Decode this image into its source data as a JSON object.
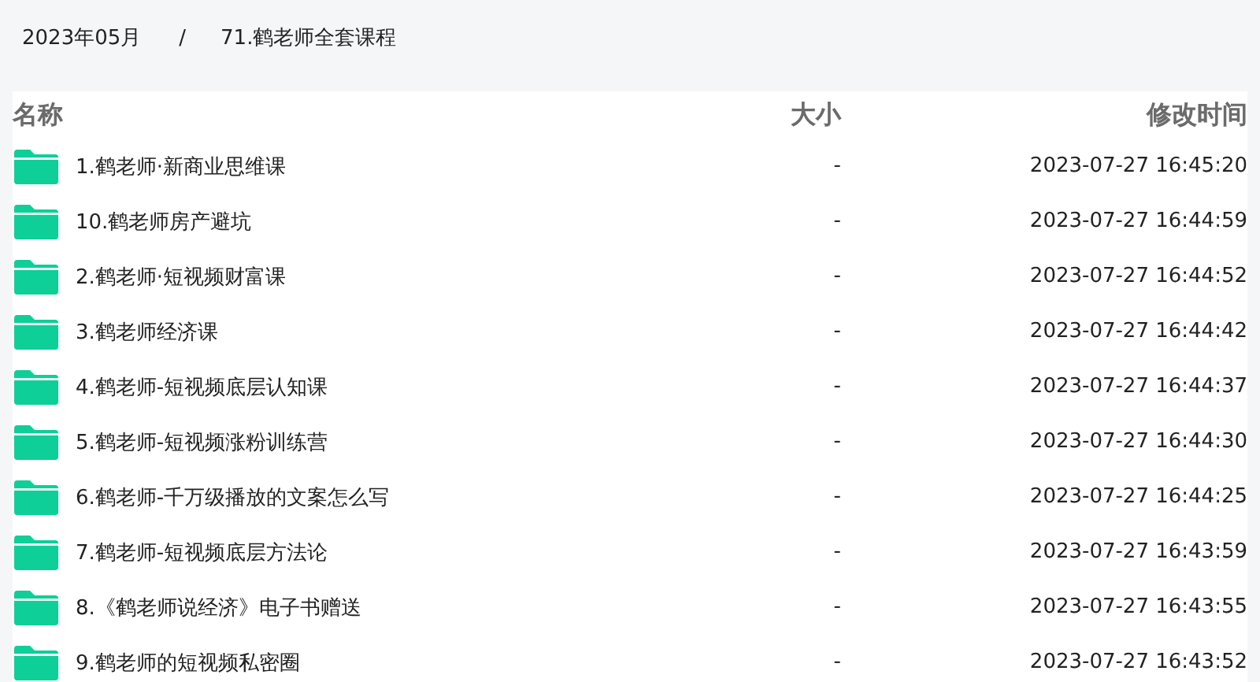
{
  "breadcrumb": {
    "items": [
      "2023年05月",
      "71.鹤老师全套课程"
    ],
    "separator": "/"
  },
  "table": {
    "columns": [
      "名称",
      "大小",
      "修改时间"
    ],
    "rows": [
      {
        "name": "1.鹤老师·新商业思维课",
        "size": "-",
        "modified": "2023-07-27 16:45:20"
      },
      {
        "name": "10.鹤老师房产避坑",
        "size": "-",
        "modified": "2023-07-27 16:44:59"
      },
      {
        "name": "2.鹤老师·短视频财富课",
        "size": "-",
        "modified": "2023-07-27 16:44:52"
      },
      {
        "name": "3.鹤老师经济课",
        "size": "-",
        "modified": "2023-07-27 16:44:42"
      },
      {
        "name": "4.鹤老师-短视频底层认知课",
        "size": "-",
        "modified": "2023-07-27 16:44:37"
      },
      {
        "name": "5.鹤老师-短视频涨粉训练营",
        "size": "-",
        "modified": "2023-07-27 16:44:30"
      },
      {
        "name": "6.鹤老师-千万级播放的文案怎么写",
        "size": "-",
        "modified": "2023-07-27 16:44:25"
      },
      {
        "name": "7.鹤老师-短视频底层方法论",
        "size": "-",
        "modified": "2023-07-27 16:43:59"
      },
      {
        "name": "8.《鹤老师说经济》电子书赠送",
        "size": "-",
        "modified": "2023-07-27 16:43:55"
      },
      {
        "name": "9.鹤老师的短视频私密圈",
        "size": "-",
        "modified": "2023-07-27 16:43:52"
      }
    ]
  }
}
